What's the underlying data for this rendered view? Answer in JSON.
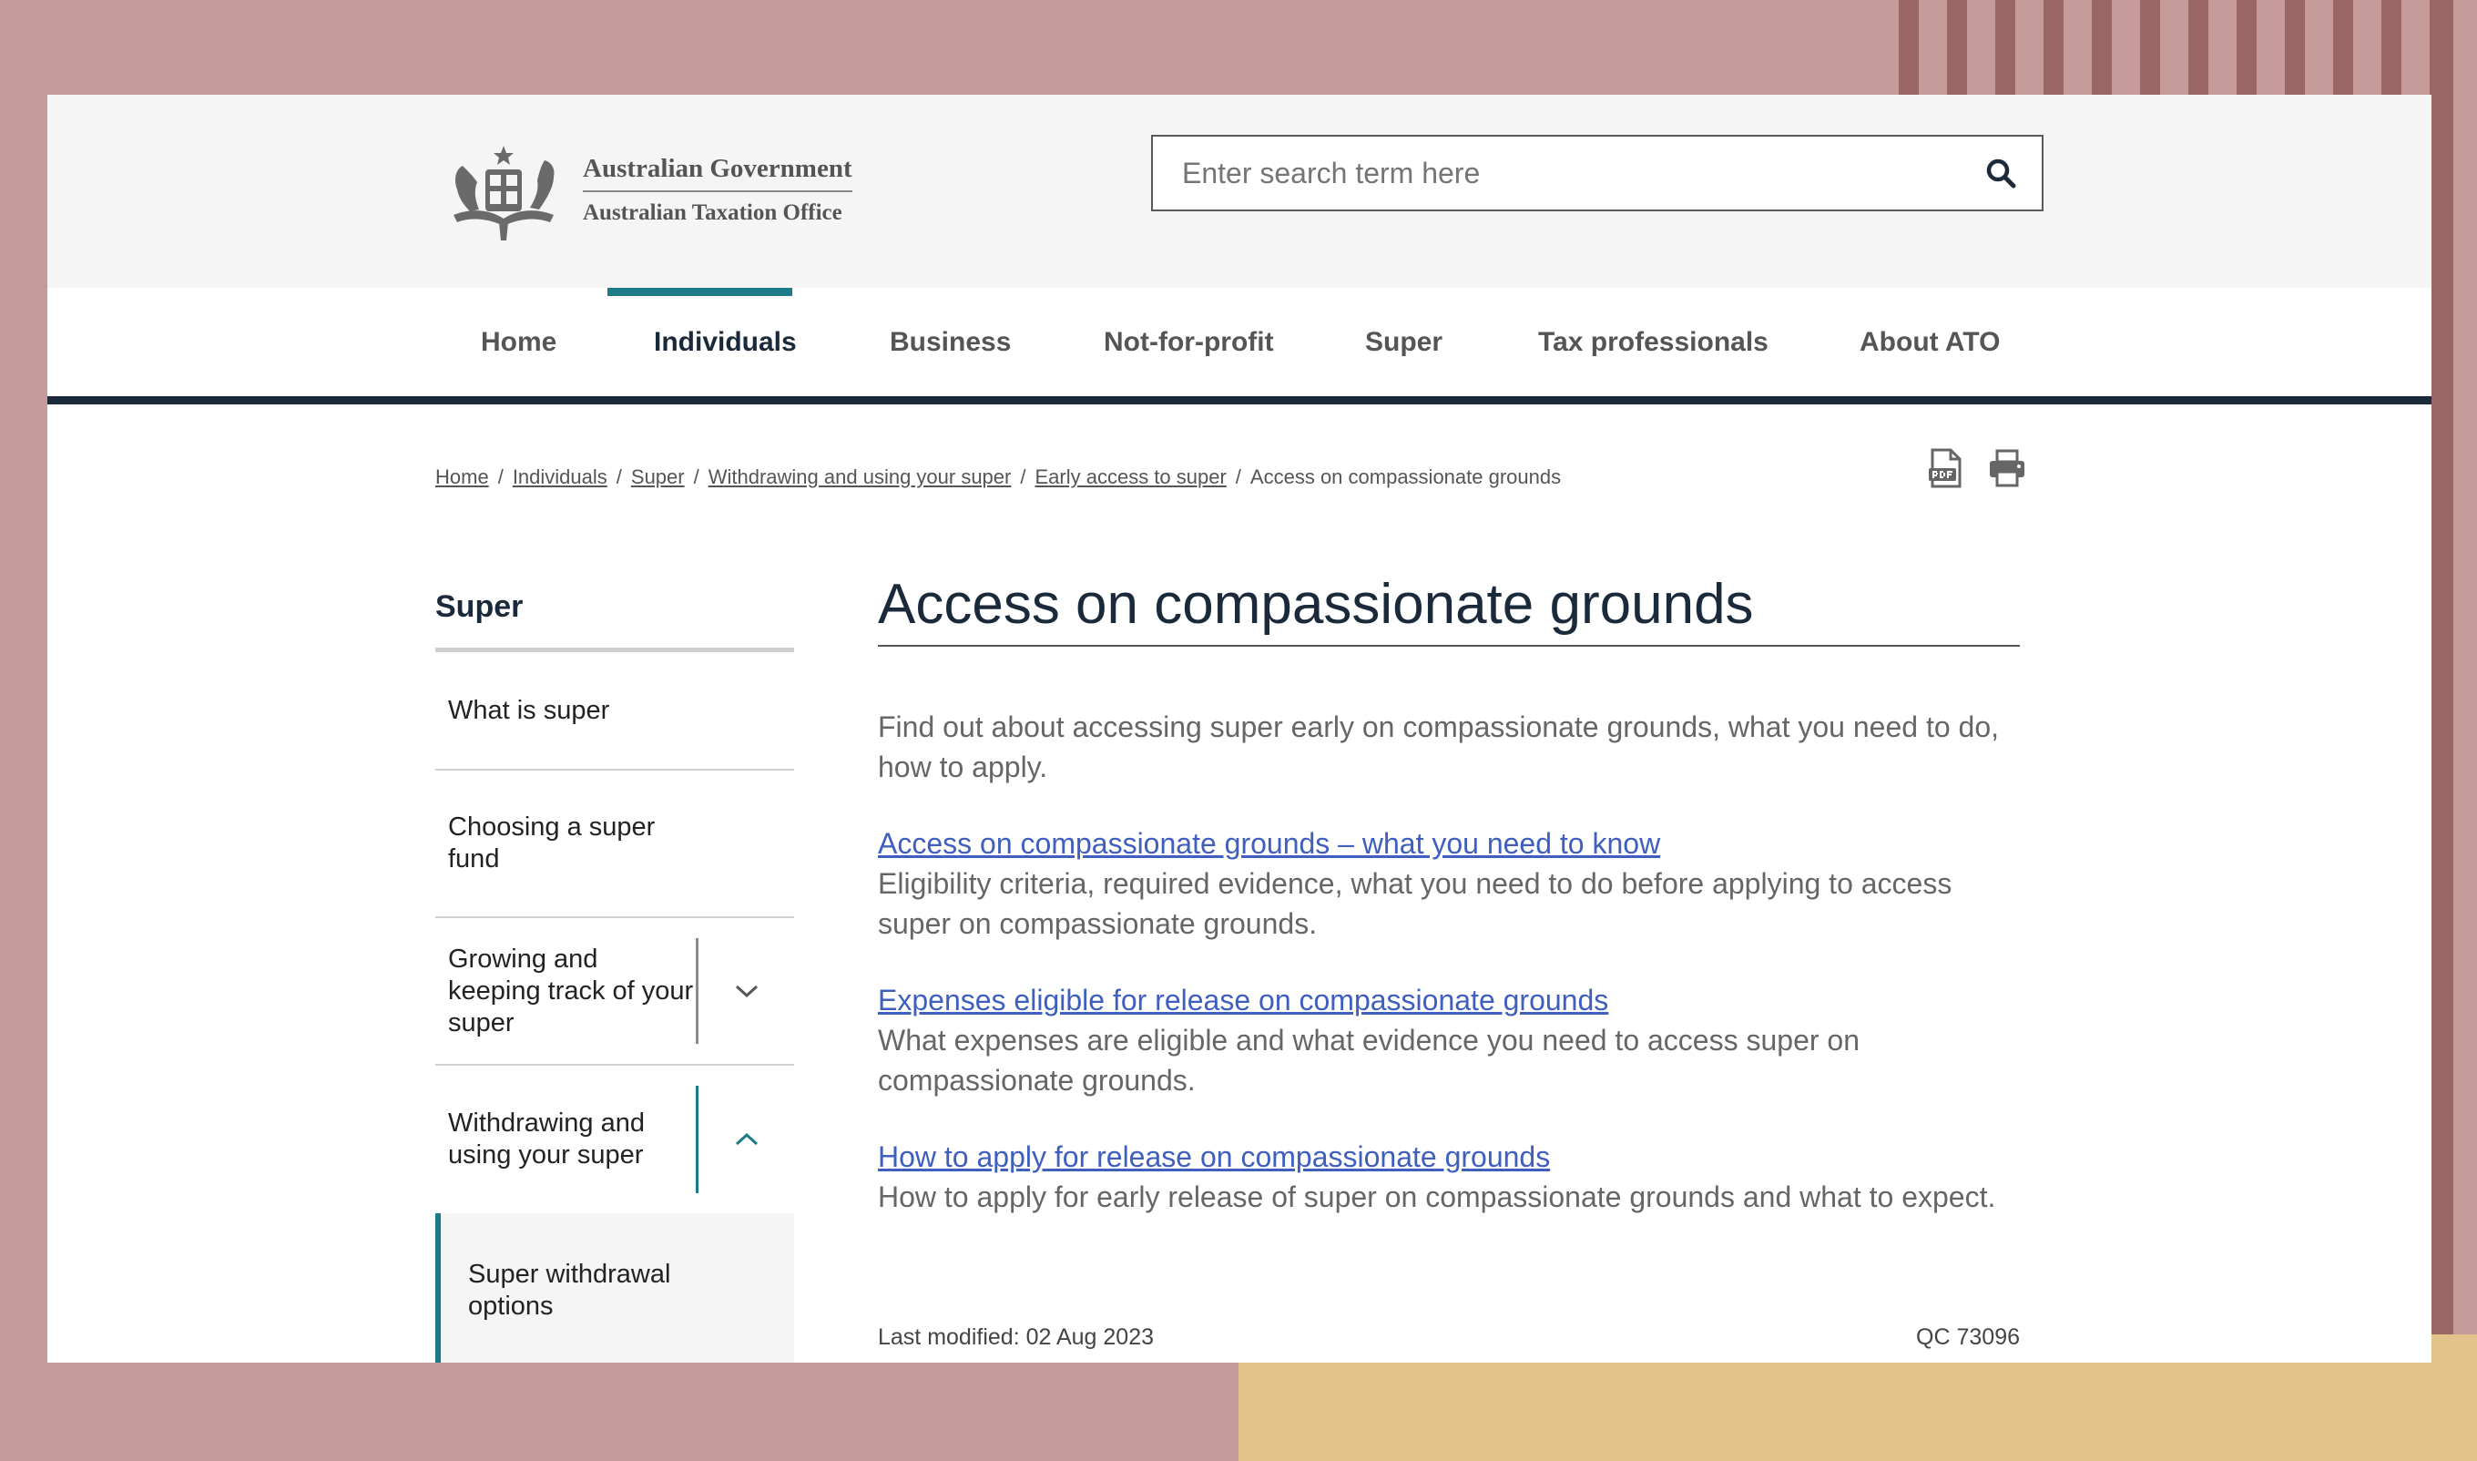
{
  "header": {
    "logo_line1": "Australian Government",
    "logo_line2": "Australian Taxation Office",
    "search_placeholder": "Enter search term here"
  },
  "nav": {
    "active": "Individuals",
    "items": [
      "Home",
      "Individuals",
      "Business",
      "Not-for-profit",
      "Super",
      "Tax professionals",
      "About ATO"
    ]
  },
  "breadcrumb": {
    "items": [
      "Home",
      "Individuals",
      "Super",
      "Withdrawing and using your super",
      "Early access to super"
    ],
    "current": "Access on compassionate grounds",
    "separator": "/"
  },
  "tools": {
    "pdf_icon": "pdf-icon",
    "print_icon": "print-icon"
  },
  "sidenav": {
    "title": "Super",
    "items": [
      {
        "label": "What is super"
      },
      {
        "label": "Choosing a super fund"
      },
      {
        "label": "Growing and keeping track of your super",
        "expandable": true,
        "expanded": false
      },
      {
        "label": "Withdrawing and using your super",
        "expandable": true,
        "expanded": true
      }
    ],
    "subitem": {
      "label": "Super withdrawal options"
    }
  },
  "main": {
    "title": "Access on compassionate grounds",
    "intro": "Find out about accessing super early on compassionate grounds, what you need to do, how to apply.",
    "links": [
      {
        "title": "Access on compassionate grounds – what you need to know",
        "description": "Eligibility criteria, required evidence, what you need to do before applying to access super on compassionate grounds."
      },
      {
        "title": "Expenses eligible for release on compassionate grounds",
        "description": "What expenses are eligible and what evidence you need to access super on compassionate grounds."
      },
      {
        "title": "How to apply for release on compassionate grounds",
        "description": "How to apply for early release of super on compassionate grounds and what to expect."
      }
    ]
  },
  "footer": {
    "last_modified": "Last modified: 02 Aug 2023",
    "qc_code": "QC 73096"
  },
  "colors": {
    "navy": "#1b2a3a",
    "teal_accent": "#1b7b86",
    "link_blue": "#3f5fbf",
    "backdrop_rose": "#c69c9a",
    "backdrop_stripe": "#9a6663",
    "backdrop_gold": "#e2c48a"
  }
}
